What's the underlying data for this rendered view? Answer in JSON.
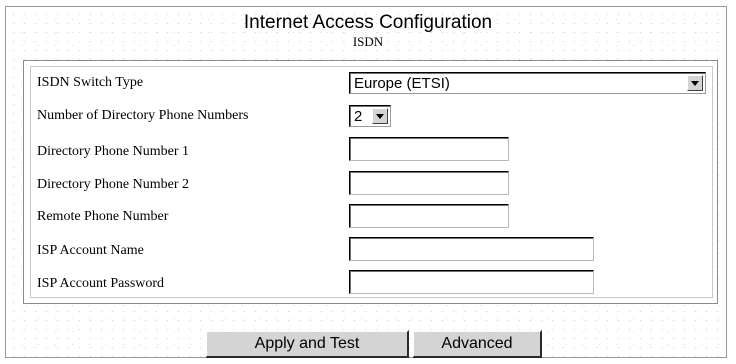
{
  "header": {
    "title": "Internet Access Configuration",
    "subtitle": "ISDN"
  },
  "form": {
    "fields": [
      {
        "label": "ISDN Switch Type",
        "type": "select",
        "value": "Europe (ETSI)"
      },
      {
        "label": "Number of Directory Phone Numbers",
        "type": "select",
        "value": "2"
      },
      {
        "label": "Directory Phone Number 1",
        "type": "text",
        "value": ""
      },
      {
        "label": "Directory Phone Number 2",
        "type": "text",
        "value": ""
      },
      {
        "label": "Remote Phone Number",
        "type": "text",
        "value": ""
      },
      {
        "label": "ISP Account Name",
        "type": "text",
        "value": ""
      },
      {
        "label": "ISP Account Password",
        "type": "password",
        "value": ""
      }
    ]
  },
  "buttons": {
    "apply_test": "Apply and Test",
    "advanced": "Advanced"
  },
  "icons": {
    "dropdown": "chevron-down-icon"
  }
}
